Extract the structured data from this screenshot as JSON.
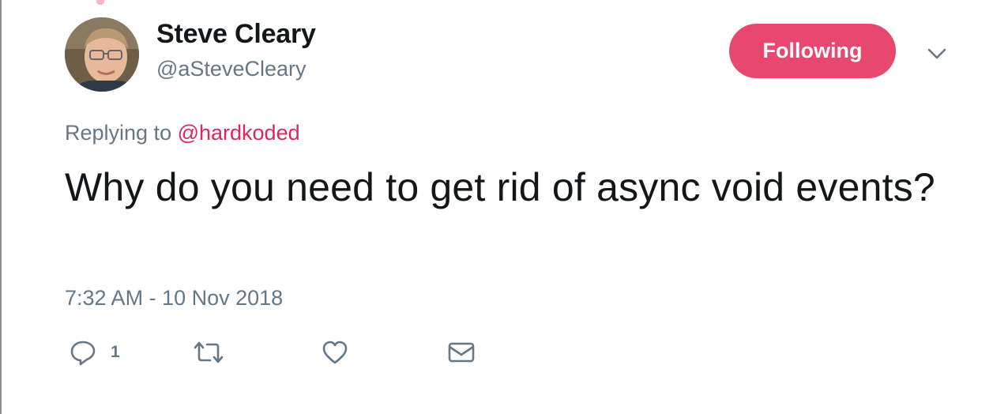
{
  "author": {
    "display_name": "Steve Cleary",
    "handle": "@aSteveCleary"
  },
  "follow_button": {
    "label": "Following"
  },
  "reply_context": {
    "prefix": "Replying to ",
    "mention": "@hardkoded"
  },
  "tweet": {
    "text": "Why do you need to get rid of async void events?",
    "timestamp": "7:32 AM - 10 Nov 2018"
  },
  "actions": {
    "reply_icon": "reply-bubble-icon",
    "reply_count": "1",
    "retweet_icon": "retweet-icon",
    "like_icon": "heart-icon",
    "dm_icon": "envelope-icon"
  },
  "colors": {
    "accent": "#e8476f",
    "mention": "#e0245e",
    "secondary_text": "#657786",
    "primary_text": "#14171a"
  }
}
